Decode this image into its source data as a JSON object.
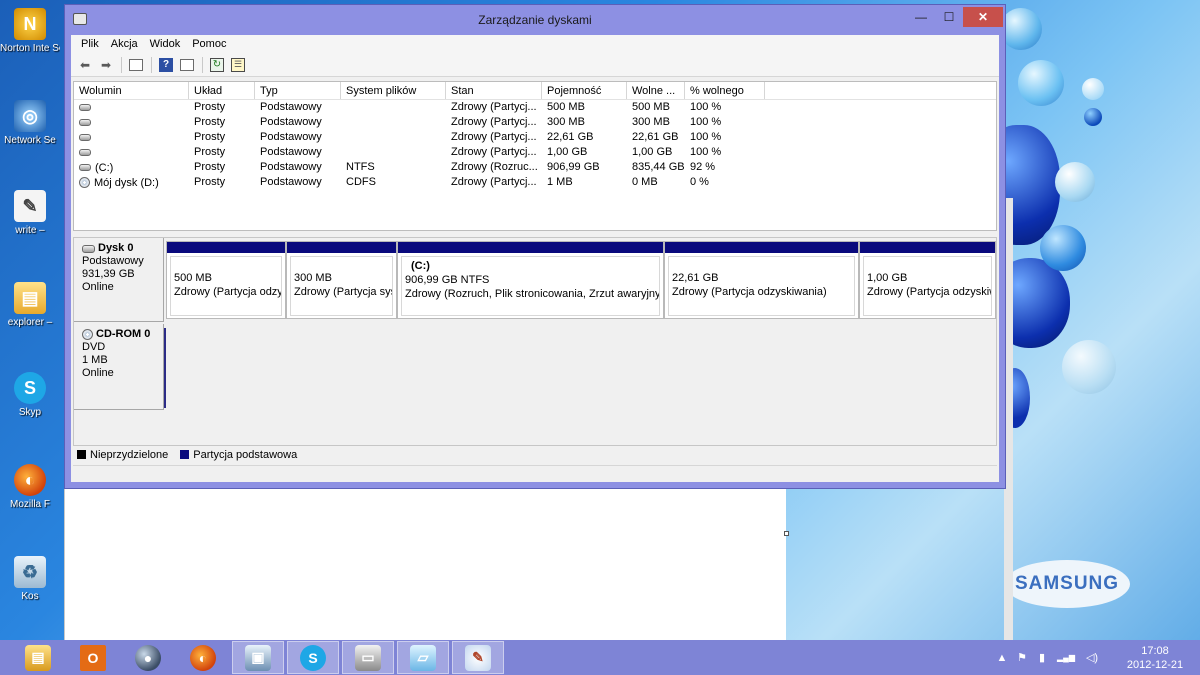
{
  "window": {
    "title": "Zarządzanie dyskami",
    "min_glyph": "—",
    "max_glyph": "☐",
    "close_glyph": "✕"
  },
  "menu": [
    "Plik",
    "Akcja",
    "Widok",
    "Pomoc"
  ],
  "toolbar_icons": [
    "back-arrow-icon",
    "forward-arrow-icon",
    "console-tree-icon",
    "help-icon",
    "show-pane-icon",
    "refresh-icon",
    "properties-icon"
  ],
  "volumes": {
    "columns": [
      "Wolumin",
      "Układ",
      "Typ",
      "System plików",
      "Stan",
      "Pojemność",
      "Wolne ...",
      "% wolnego",
      ""
    ],
    "rows": [
      {
        "name": "",
        "layout": "Prosty",
        "type": "Podstawowy",
        "fs": "",
        "status": "Zdrowy (Partycj...",
        "capacity": "500 MB",
        "free": "500 MB",
        "pct": "100 %",
        "icon": "drive"
      },
      {
        "name": "",
        "layout": "Prosty",
        "type": "Podstawowy",
        "fs": "",
        "status": "Zdrowy (Partycj...",
        "capacity": "300 MB",
        "free": "300 MB",
        "pct": "100 %",
        "icon": "drive"
      },
      {
        "name": "",
        "layout": "Prosty",
        "type": "Podstawowy",
        "fs": "",
        "status": "Zdrowy (Partycj...",
        "capacity": "22,61 GB",
        "free": "22,61 GB",
        "pct": "100 %",
        "icon": "drive"
      },
      {
        "name": "",
        "layout": "Prosty",
        "type": "Podstawowy",
        "fs": "",
        "status": "Zdrowy (Partycj...",
        "capacity": "1,00 GB",
        "free": "1,00 GB",
        "pct": "100 %",
        "icon": "drive"
      },
      {
        "name": "(C:)",
        "layout": "Prosty",
        "type": "Podstawowy",
        "fs": "NTFS",
        "status": "Zdrowy (Rozruc...",
        "capacity": "906,99 GB",
        "free": "835,44 GB",
        "pct": "92 %",
        "icon": "drive"
      },
      {
        "name": "Mój dysk (D:)",
        "layout": "Prosty",
        "type": "Podstawowy",
        "fs": "CDFS",
        "status": "Zdrowy (Partycj...",
        "capacity": "1 MB",
        "free": "0 MB",
        "pct": "0 %",
        "icon": "cd"
      }
    ]
  },
  "disks": {
    "disk0": {
      "name": "Dysk 0",
      "type": "Podstawowy",
      "size": "931,39 GB",
      "status": "Online"
    },
    "cdrom0": {
      "name": "CD-ROM 0",
      "type": "DVD",
      "size": "1 MB",
      "status": "Online"
    }
  },
  "partitions": [
    {
      "name": "",
      "size": "500 MB",
      "status": "Zdrowy (Partycja odzyskiwania)"
    },
    {
      "name": "",
      "size": "300 MB",
      "status": "Zdrowy (Partycja systemowa EFI)"
    },
    {
      "name": "(C:)",
      "size": "906,99 GB NTFS",
      "status": "Zdrowy (Rozruch, Plik stronicowania, Zrzut awaryjny, Partycja podstawowa)"
    },
    {
      "name": "",
      "size": "22,61 GB",
      "status": "Zdrowy (Partycja odzyskiwania)"
    },
    {
      "name": "",
      "size": "1,00 GB",
      "status": "Zdrowy (Partycja odzyskiwania)"
    }
  ],
  "legend": {
    "unallocated": "Nieprzydzielone",
    "primary": "Partycja podstawowa",
    "unallocated_color": "#000000",
    "primary_color": "#0a0a7d"
  },
  "desktop_icons": [
    {
      "label": "Norton Inte Security",
      "icon": "norton-icon",
      "glyph": "N"
    },
    {
      "label": "Network Se",
      "icon": "network-icon",
      "glyph": "◎"
    },
    {
      "label": "write –",
      "icon": "write-icon",
      "glyph": "✎"
    },
    {
      "label": "explorer –",
      "icon": "explorer-icon",
      "glyph": "▤"
    },
    {
      "label": "Skyp",
      "icon": "skype-icon",
      "glyph": "S"
    },
    {
      "label": "Mozilla F",
      "icon": "firefox-icon",
      "glyph": "◐"
    },
    {
      "label": "Kos",
      "icon": "recycle-bin-icon",
      "glyph": "♻"
    }
  ],
  "brand": "SAMSUNG",
  "taskbar": {
    "apps": [
      {
        "name": "explorer",
        "glyph": "▤",
        "active": false
      },
      {
        "name": "office",
        "glyph": "O",
        "active": false
      },
      {
        "name": "globe",
        "glyph": "●",
        "active": false
      },
      {
        "name": "firefox",
        "glyph": "◐",
        "active": false
      },
      {
        "name": "rdp",
        "glyph": "▣",
        "active": true
      },
      {
        "name": "skype",
        "glyph": "S",
        "active": true
      },
      {
        "name": "disk-management",
        "glyph": "▭",
        "active": true
      },
      {
        "name": "notepad",
        "glyph": "▱",
        "active": true
      },
      {
        "name": "paint",
        "glyph": "✎",
        "active": true
      }
    ],
    "tray_icons": [
      "▲",
      "⚑",
      "▮",
      "▂▄▆",
      "◁)"
    ],
    "time": "17:08",
    "date": "2012-12-21"
  }
}
